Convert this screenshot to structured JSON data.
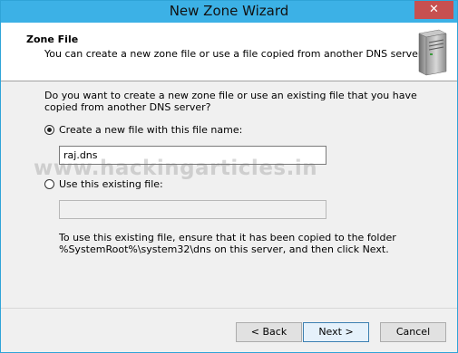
{
  "window": {
    "title": "New Zone Wizard",
    "close_glyph": "✕"
  },
  "header": {
    "title": "Zone File",
    "subtitle": "You can create a new zone file or use a file copied from another DNS server.",
    "icon": "server-icon"
  },
  "content": {
    "question": "Do you want to create a new zone file or use an existing file that you have copied from another DNS server?",
    "option_new": {
      "label": "Create a new file with this file name:",
      "checked": true,
      "value": "raj.dns"
    },
    "option_existing": {
      "label": "Use this existing file:",
      "checked": false,
      "value": ""
    },
    "note_line1": "To use this existing file, ensure that it has been copied to the folder",
    "note_line2": "%SystemRoot%\\system32\\dns on this server, and then click Next.",
    "watermark": "www.hackingarticles.in"
  },
  "footer": {
    "back_label": "< Back",
    "next_label": "Next >",
    "cancel_label": "Cancel"
  },
  "colors": {
    "titlebar": "#3cb1e6",
    "close": "#c75050",
    "default_button_border": "#3c7fb1"
  }
}
